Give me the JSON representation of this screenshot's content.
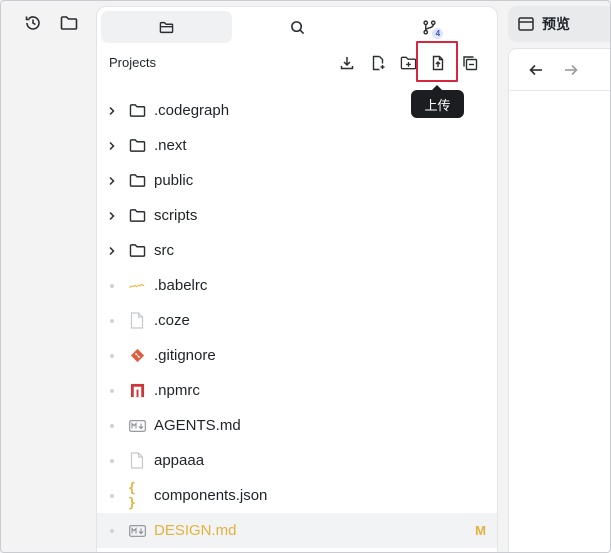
{
  "rail": {
    "history_icon": "history-icon",
    "folder_icon": "folder-icon"
  },
  "explorer": {
    "tabs": [
      {
        "icon": "folder-icon",
        "active": true
      },
      {
        "icon": "search-icon",
        "active": false
      },
      {
        "icon": "source-control-icon",
        "active": false,
        "badge": "4"
      }
    ],
    "title": "Projects",
    "toolbar": [
      "download-icon",
      "new-file-icon",
      "new-folder-icon",
      "upload-icon",
      "collapse-all-icon"
    ],
    "tooltip": "上传",
    "items": [
      {
        "name": ".codegraph",
        "kind": "folder"
      },
      {
        "name": ".next",
        "kind": "folder"
      },
      {
        "name": "public",
        "kind": "folder"
      },
      {
        "name": "scripts",
        "kind": "folder"
      },
      {
        "name": "src",
        "kind": "folder"
      },
      {
        "name": ".babelrc",
        "kind": "babel"
      },
      {
        "name": ".coze",
        "kind": "file"
      },
      {
        "name": ".gitignore",
        "kind": "git"
      },
      {
        "name": ".npmrc",
        "kind": "npm"
      },
      {
        "name": "AGENTS.md",
        "kind": "markdown"
      },
      {
        "name": "appaaa",
        "kind": "file"
      },
      {
        "name": "components.json",
        "kind": "json"
      },
      {
        "name": "DESIGN.md",
        "kind": "markdown",
        "status": "M",
        "selected": true
      }
    ]
  },
  "preview": {
    "title": "预览",
    "back_icon": "arrow-left-icon",
    "forward_icon": "arrow-right-icon"
  },
  "colors": {
    "modified": "#e3b23c",
    "highlight": "#d7263d",
    "git": "#e05d44",
    "npm": "#cb3837"
  }
}
